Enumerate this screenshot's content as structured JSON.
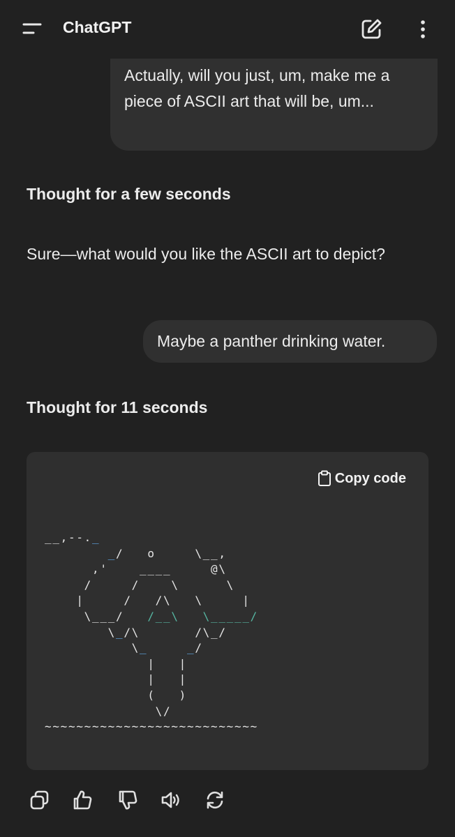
{
  "app": {
    "title": "ChatGPT"
  },
  "icons": {
    "menu": "menu-icon",
    "new_chat": "edit-icon",
    "more": "more-vertical-icon",
    "copy": "clipboard-icon",
    "copy_action": "copy-icon",
    "like": "thumbs-up-icon",
    "dislike": "thumbs-down-icon",
    "read_aloud": "speaker-icon",
    "regenerate": "regenerate-icon"
  },
  "messages": [
    {
      "role": "user",
      "text": "Actually, will you just, um, make me a piece of ASCII art that will be, um..."
    },
    {
      "role": "thought",
      "text": "Thought for a few seconds"
    },
    {
      "role": "assistant",
      "text": "Sure—what would you like the ASCII art to depict?"
    },
    {
      "role": "user",
      "text": "Maybe a panther drinking water."
    },
    {
      "role": "thought",
      "text": "Thought for 11 seconds"
    }
  ],
  "code_block": {
    "copy_label": "Copy code",
    "ascii_lines": [
      "__,--._",
      "        _/   o     \\__,",
      "      ,'    ____     @\\",
      "     /     /    \\      \\",
      "    |     /   /\\   \\     |",
      "     \\___/   /__\\   \\_____/",
      "        \\_/\\       /\\_/",
      "           \\_     _/",
      "             |   |",
      "             |   |",
      "             (   )",
      "              \\/",
      "~~~~~~~~~~~~~~~~~~~~~~~~~~~"
    ]
  },
  "colors": {
    "background": "#212121",
    "bubble": "#303030",
    "code_bg": "#2f2f2f",
    "text": "#ececec",
    "ascii_blue": "#61afef",
    "ascii_teal": "#56b6a2"
  }
}
